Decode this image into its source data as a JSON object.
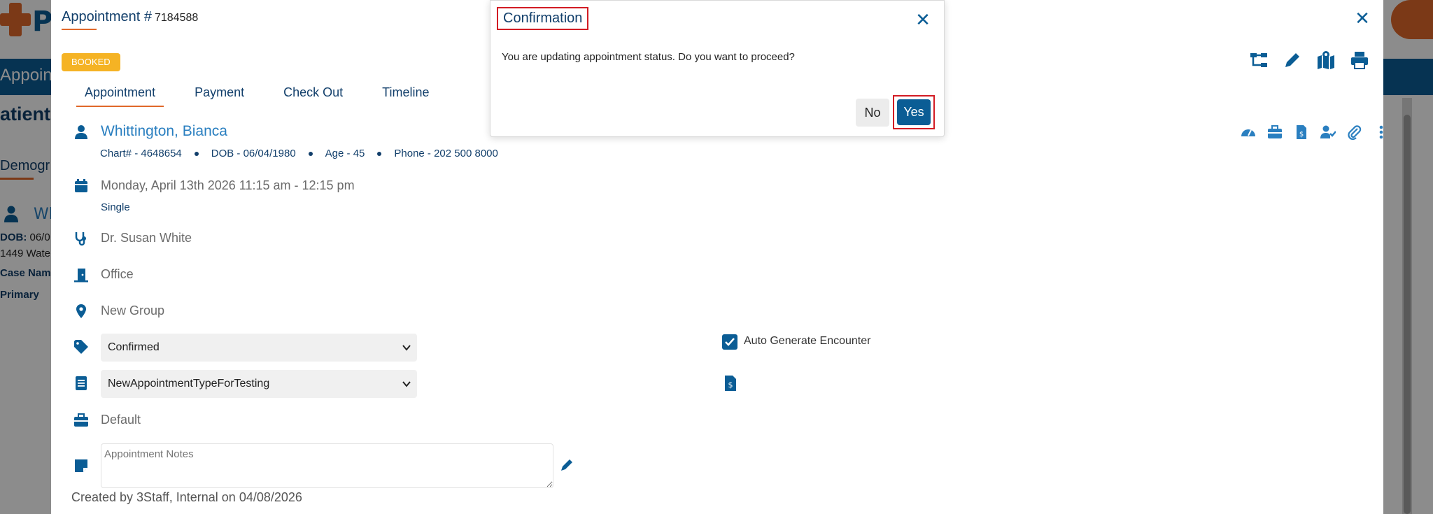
{
  "background": {
    "logo_letter": "P",
    "nav_text": "Appoin",
    "page_title": "atient",
    "section": "Demogr",
    "person_name": "Wh",
    "lines": [
      {
        "label": "DOB:",
        "value": "06/0"
      },
      {
        "label": "",
        "value": "1449 Wate"
      },
      {
        "label": "Case Nam",
        "value": ""
      },
      {
        "label": "Primary",
        "value": ""
      }
    ]
  },
  "modal": {
    "title": "Appointment #",
    "number": "7184588",
    "status_badge": "BOOKED",
    "tabs": [
      {
        "label": "Appointment",
        "active": true
      },
      {
        "label": "Payment",
        "active": false
      },
      {
        "label": "Check Out",
        "active": false
      },
      {
        "label": "Timeline",
        "active": false
      }
    ],
    "top_actions": [
      "hierarchy-icon",
      "pencil-icon",
      "map-icon",
      "print-icon"
    ],
    "row_icons": [
      "dashboard-icon",
      "briefcase-icon",
      "billing-document-icon",
      "user-check-icon",
      "paperclip-icon",
      "more-vertical-icon"
    ],
    "patient": {
      "name": "Whittington, Bianca",
      "chart": "Chart# - 4648654",
      "dob": "DOB - 06/04/1980",
      "age": "Age - 45",
      "phone": "Phone - 202 500 8000"
    },
    "datetime": "Monday, April 13th 2026 11:15 am - 12:15 pm",
    "recurrence": "Single",
    "provider": "Dr. Susan White",
    "location": "Office",
    "group": "New Group",
    "status_select": "Confirmed",
    "type_select": "NewAppointmentTypeForTesting",
    "auto_generate_label": "Auto Generate Encounter",
    "auto_generate_checked": true,
    "case": "Default",
    "notes_placeholder": "Appointment Notes",
    "created": "Created by 3Staff, Internal on 04/08/2026"
  },
  "confirm": {
    "title": "Confirmation",
    "message": "You are updating appointment status. Do you want to proceed?",
    "no_label": "No",
    "yes_label": "Yes"
  },
  "colors": {
    "primary": "#0b5d95",
    "accent_orange": "#e0682a",
    "badge_yellow": "#f5b324",
    "highlight_red": "#d21c24",
    "link_blue": "#2a7fc0"
  }
}
